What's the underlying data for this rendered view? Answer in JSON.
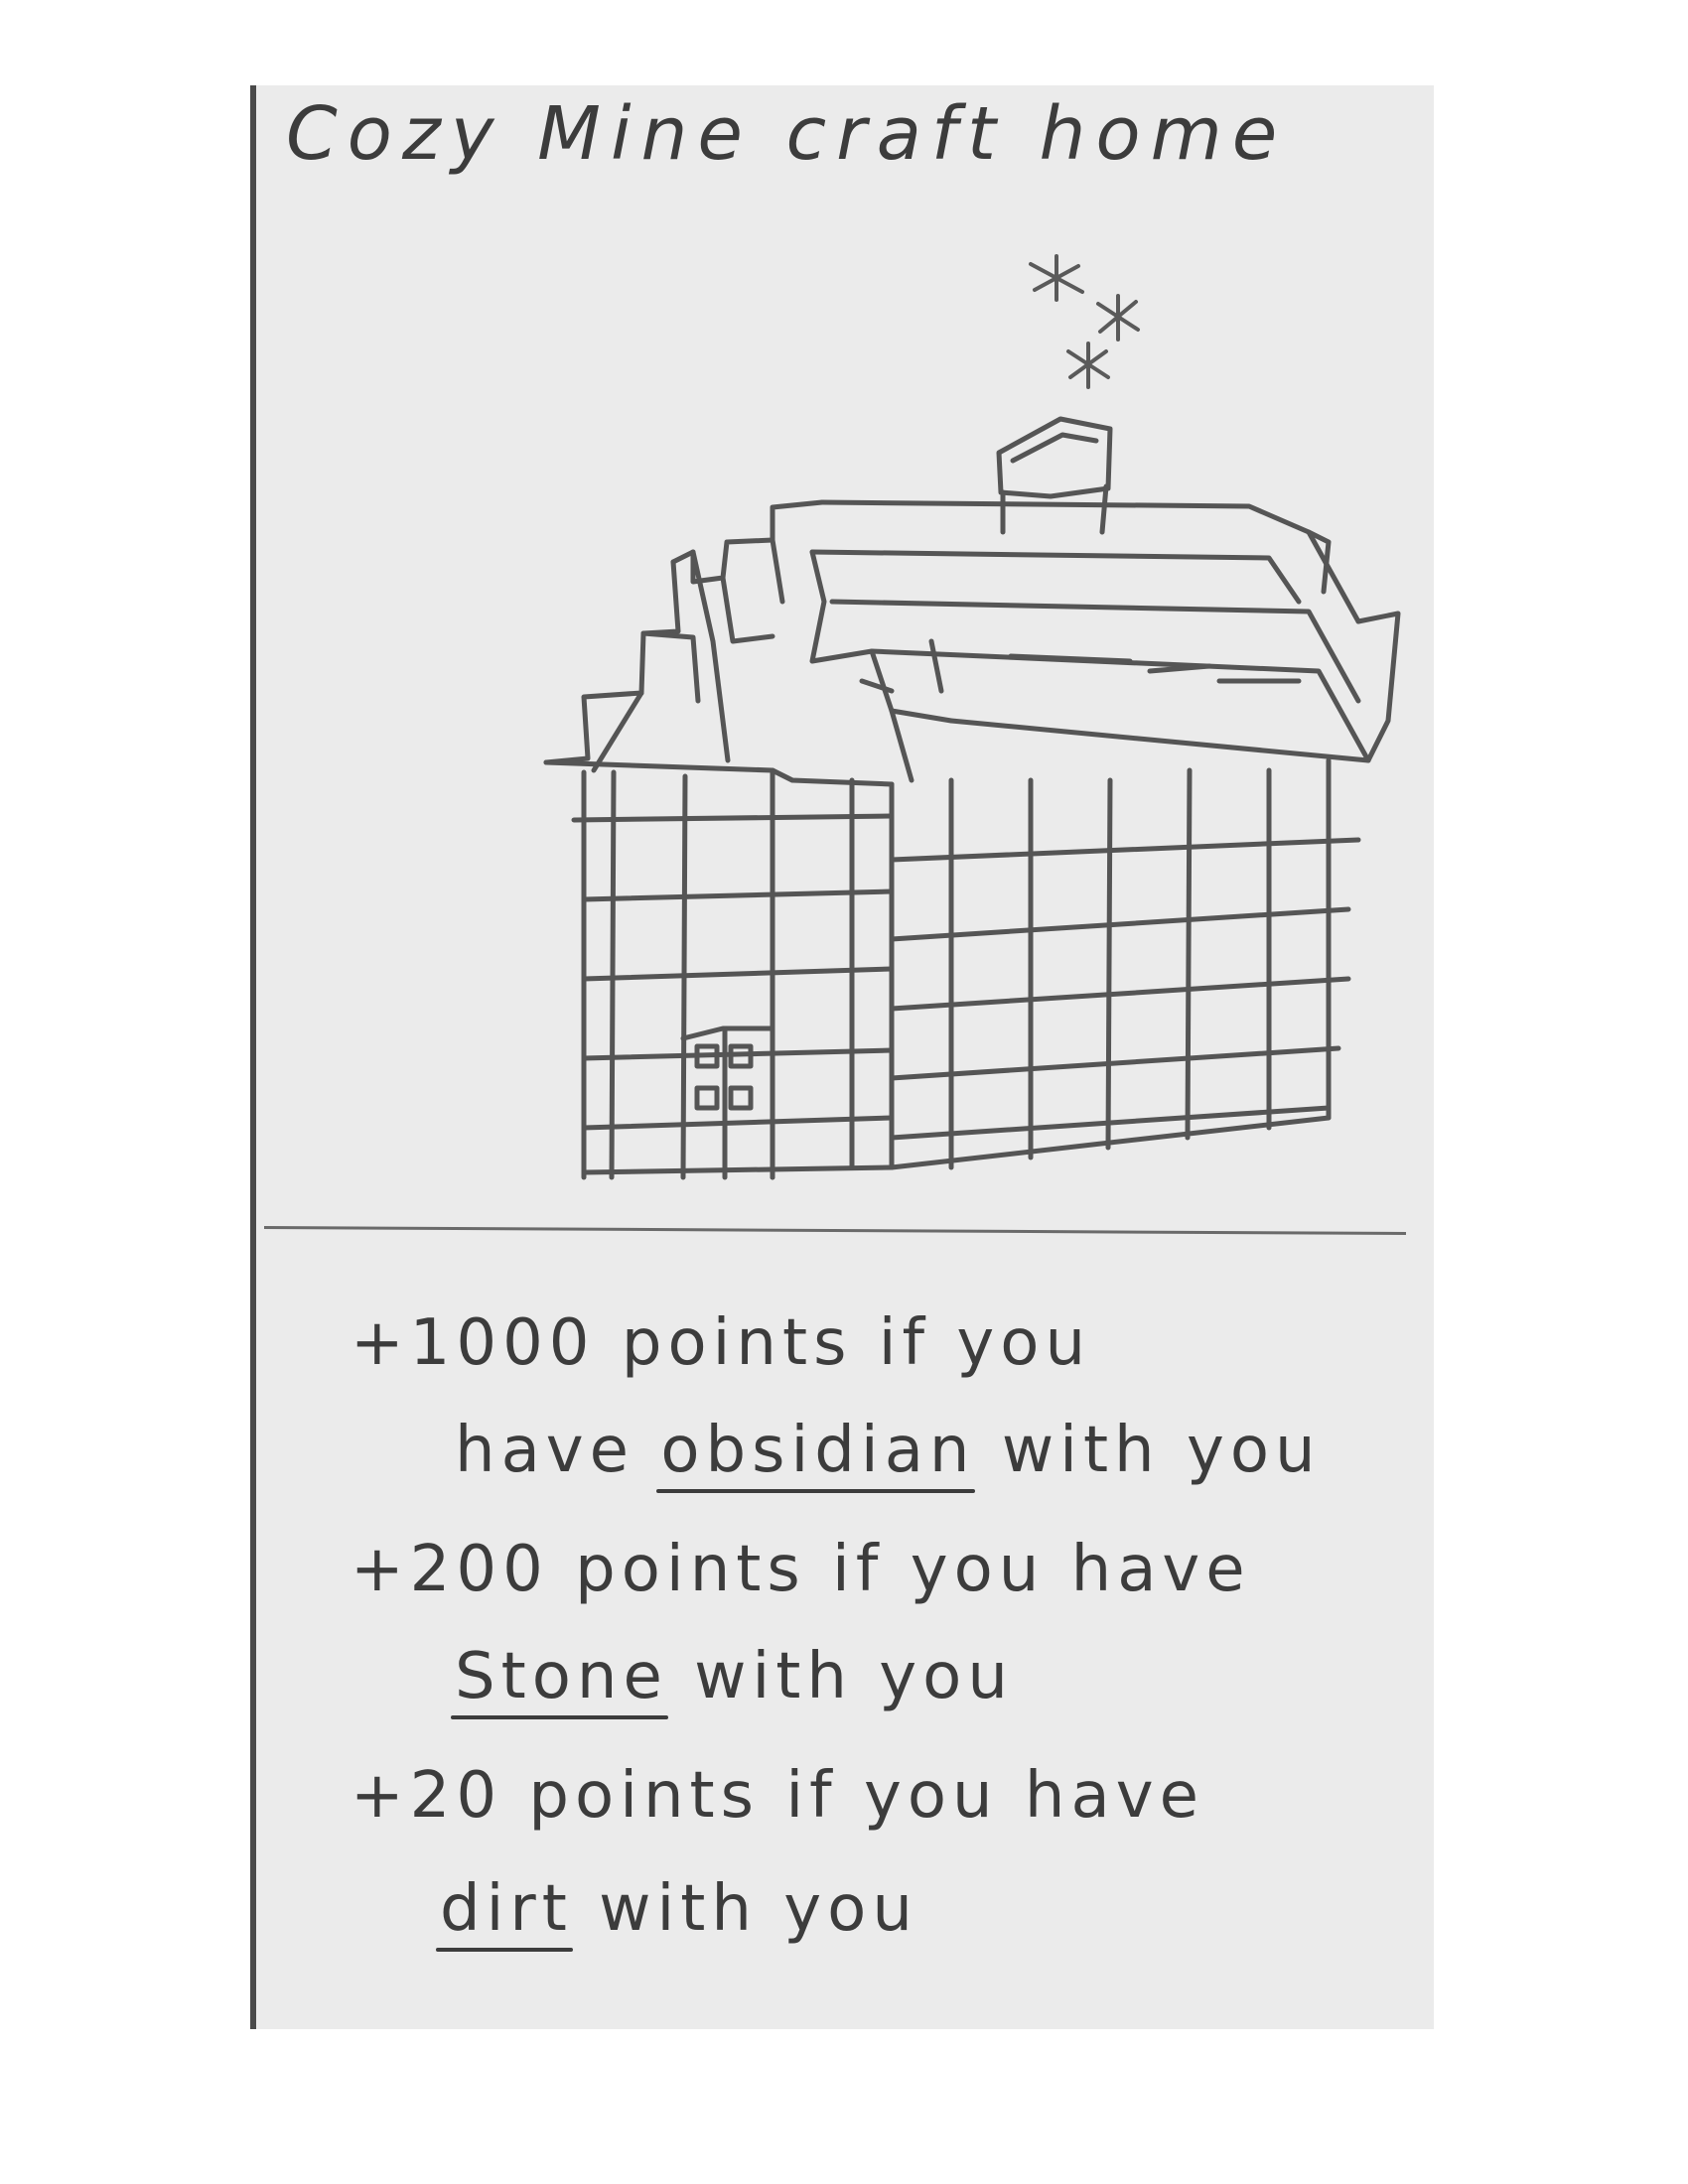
{
  "title": "Cozy Mine craft home",
  "rules": [
    {
      "points": "+1000 points if you",
      "pre": "have",
      "item": "obsidian",
      "post": "with you"
    },
    {
      "points": "+200 points if you have",
      "pre": "",
      "item": "Stone",
      "post": "with you"
    },
    {
      "points": "+20 points if you have",
      "pre": "",
      "item": "dirt",
      "post": "with you"
    }
  ],
  "colors": {
    "paper": "#ebebeb",
    "pencil": "#3c3c3c",
    "background": "#ffffff"
  }
}
